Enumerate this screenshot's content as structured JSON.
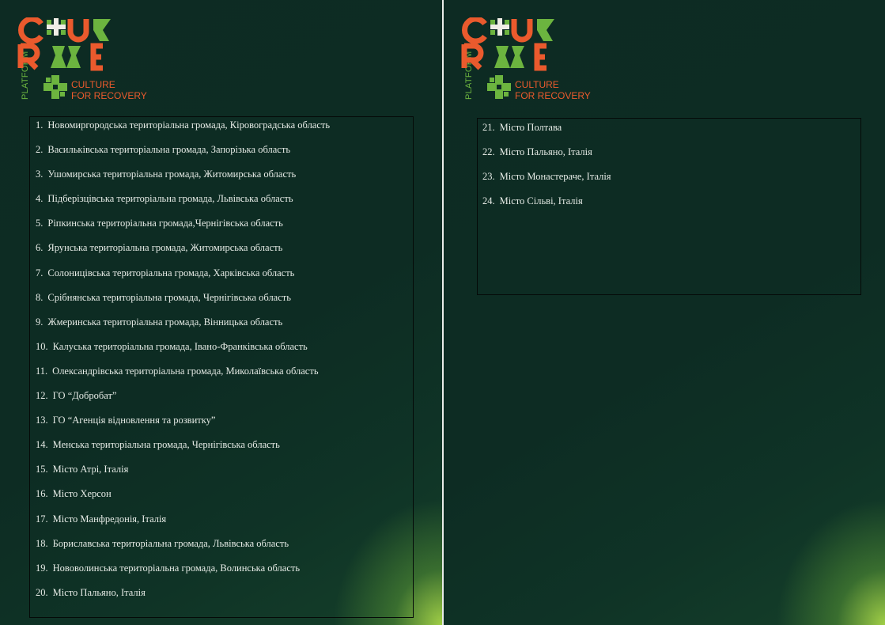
{
  "logo": {
    "platform": "PLATFORM",
    "sub_line1": "CULTURE",
    "sub_line2": "FOR RECOVERY",
    "colors": {
      "orange": "#ea5a2d",
      "green": "#6cb43f"
    }
  },
  "left_list": [
    {
      "num": "1.",
      "text": "Новомиргородська територіальна громада, Кіровоградська область"
    },
    {
      "num": "2.",
      "text": "Васильківська територіальна громада, Запорізька область"
    },
    {
      "num": "3.",
      "text": "Ушомирська територіальна громада, Житомирська область"
    },
    {
      "num": "4.",
      "text": "Підберізцівська територіальна громада, Львівська область"
    },
    {
      "num": "5.",
      "text": "Ріпкинська територіальна громада,Чернігівська область"
    },
    {
      "num": "6.",
      "text": "Ярунська територіальна громада, Житомирська область"
    },
    {
      "num": "7.",
      "text": "Солоницівська територіальна громада, Харківська область"
    },
    {
      "num": "8.",
      "text": "Срібнянська територіальна громада, Чернігівська область"
    },
    {
      "num": "9.",
      "text": "Жмеринська територіальна громада, Вінницька область"
    },
    {
      "num": "10.",
      "text": "Калуська територіальна громада, Івано-Франківська область"
    },
    {
      "num": "11.",
      "text": "Олександрівська територіальна громада, Миколаївська область"
    },
    {
      "num": "12.",
      "text": "ГО “Добробат”"
    },
    {
      "num": "13.",
      "text": "ГО “Агенція відновлення та розвитку”"
    },
    {
      "num": "14.",
      "text": "Менська територіальна громада, Чернігівська область"
    },
    {
      "num": "15.",
      "text": "Місто Атрі, Італія"
    },
    {
      "num": "16.",
      "text": "Місто Херсон"
    },
    {
      "num": "17.",
      "text": "Місто Манфредонія, Італія"
    },
    {
      "num": "18.",
      "text": "Бориславська територіальна громада, Львівська область"
    },
    {
      "num": "19.",
      "text": "Нововолинська територіальна громада, Волинська область"
    },
    {
      "num": "20.",
      "text": "Місто Пальяно, Італія"
    }
  ],
  "right_list": [
    {
      "num": "21.",
      "text": "Місто Полтава"
    },
    {
      "num": "22.",
      "text": "Місто Пальяно, Італія"
    },
    {
      "num": "23.",
      "text": "Місто Монастераче, Італія"
    },
    {
      "num": "24.",
      "text": "Місто Сільві, Італія"
    }
  ]
}
